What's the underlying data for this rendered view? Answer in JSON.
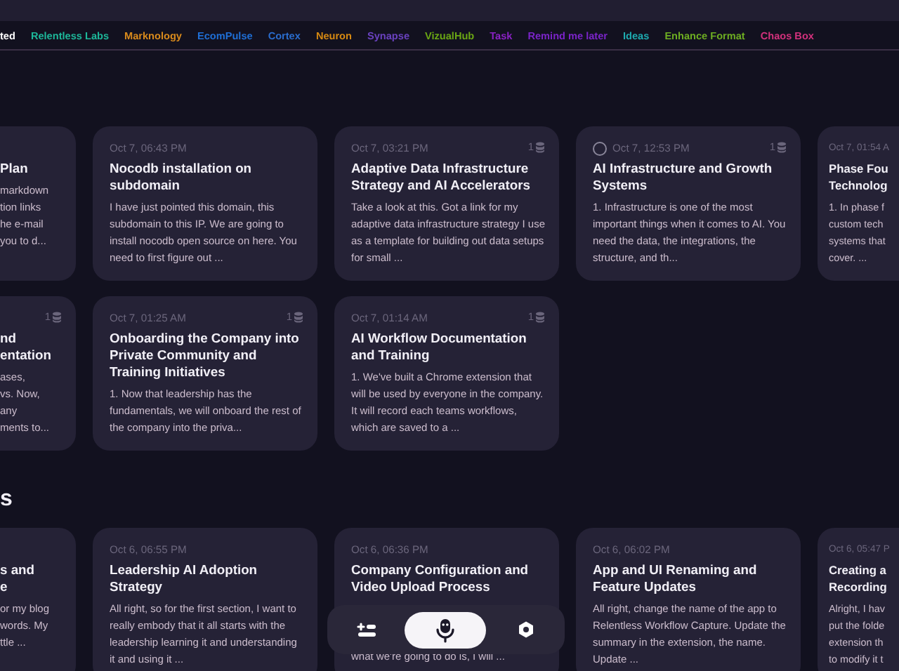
{
  "tags": [
    {
      "label": "ted",
      "selected": true
    },
    {
      "label": "Relentless Labs",
      "color": "#1db89a",
      "selected": false
    },
    {
      "label": "Marknology",
      "color": "#d88a1c",
      "selected": false
    },
    {
      "label": "EcomPulse",
      "color": "#1f6fd6",
      "selected": false
    },
    {
      "label": "Cortex",
      "color": "#2a6ccc",
      "selected": false
    },
    {
      "label": "Neuron",
      "color": "#d68912",
      "selected": false
    },
    {
      "label": "Synapse",
      "color": "#6a42c0",
      "selected": false
    },
    {
      "label": "VizualHub",
      "color": "#6aa614",
      "selected": false
    },
    {
      "label": "Task",
      "color": "#8a22c4",
      "selected": false
    },
    {
      "label": "Remind me later",
      "color": "#7a24c8",
      "selected": false
    },
    {
      "label": "Ideas",
      "color": "#1eabb0",
      "selected": false
    },
    {
      "label": "Enhance Format",
      "color": "#6dad22",
      "selected": false
    },
    {
      "label": "Chaos Box",
      "color": "#d2317c",
      "selected": false
    }
  ],
  "sections": [
    {
      "rows": [
        [
          {
            "kind": "clipped-left",
            "title_lines": [
              "Plan"
            ],
            "body_lines": [
              "markdown",
              "tion links",
              "he e-mail",
              "you to d..."
            ]
          },
          {
            "kind": "full",
            "date": "Oct 7, 06:43 PM",
            "title": "Nocodb installation on subdomain",
            "body": "I have just pointed this domain, this subdomain to this IP. We are going to install nocodb open source on here. You need to first figure out ..."
          },
          {
            "kind": "full",
            "date": "Oct 7, 03:21 PM",
            "badge": "1",
            "title": "Adaptive Data Infrastructure Strategy and AI Accelerators",
            "body": "Take a look at this. Got a link for my adaptive data infrastructure strategy I use as a template for building out data setups for small ..."
          },
          {
            "kind": "full",
            "date": "Oct 7, 12:53 PM",
            "badge": "1",
            "checked": false,
            "title": "AI Infrastructure and Growth Systems",
            "body": "1. Infrastructure is one of the most important things when it comes to AI. You need the data, the integrations, the structure, and th..."
          },
          {
            "kind": "clipped-right",
            "date": "Oct 7, 01:54 A",
            "title_lines": [
              "Phase Fou",
              "Technolog"
            ],
            "body_lines": [
              "1. In phase f",
              "custom tech",
              "systems that",
              "cover.  ..."
            ]
          }
        ],
        [
          {
            "kind": "clipped-left",
            "badge": "1",
            "title_lines": [
              "nd",
              "entation"
            ],
            "body_lines": [
              "ases,",
              "vs. Now,",
              "any",
              "ments to..."
            ]
          },
          {
            "kind": "full",
            "date": "Oct 7, 01:25 AM",
            "badge": "1",
            "title": "Onboarding the Company into Private Community and Training Initiatives",
            "body": "1. Now that leadership has the fundamentals, we will onboard the rest of the company into the priva..."
          },
          {
            "kind": "full",
            "date": "Oct 7, 01:14 AM",
            "badge": "1",
            "title": "AI Workflow Documentation and Training",
            "body": "1. We've built a Chrome extension that will be used by everyone in the company. It will record each teams workflows, which are saved to a ..."
          }
        ]
      ]
    },
    {
      "heading": "s",
      "rows": [
        [
          {
            "kind": "clipped-left",
            "title_lines": [
              "s and",
              "e"
            ],
            "body_lines": [
              "or my blog",
              "words. My",
              "ttle ..."
            ]
          },
          {
            "kind": "full",
            "date": "Oct 6, 06:55 PM",
            "title": "Leadership AI Adoption Strategy",
            "body": "All right, so for the first section, I want to really embody that it all starts with the leadership learning it and understanding it and using it ..."
          },
          {
            "kind": "behind-toolbar",
            "date": "Oct 6, 06:36 PM",
            "title": "Company Configuration and Video Upload Process",
            "body_lines": [
              "what we're going to do is, I will ..."
            ]
          },
          {
            "kind": "full",
            "date": "Oct 6, 06:02 PM",
            "title": "App and UI Renaming and Feature Updates",
            "body": "All right, change the name of the app to Relentless Workflow Capture. Update the summary in the extension, the name. Update ..."
          },
          {
            "kind": "clipped-right",
            "date": "Oct 6, 05:47 P",
            "title_lines": [
              "Creating a",
              "Recording"
            ],
            "body_lines": [
              "Alright, I hav",
              "put the folde",
              "extension th",
              "to modify it t"
            ]
          }
        ]
      ]
    }
  ],
  "toolbar": [
    {
      "kind": "add-list",
      "selected": false
    },
    {
      "kind": "record",
      "selected": true
    },
    {
      "kind": "settings",
      "selected": false
    }
  ]
}
